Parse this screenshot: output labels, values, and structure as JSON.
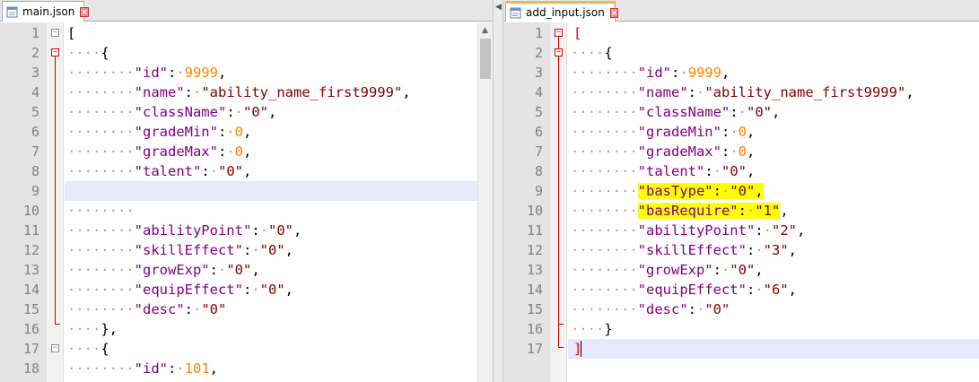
{
  "left_tab": {
    "label": "main.json",
    "icon": "json-file-icon",
    "close": "close-tab-icon"
  },
  "right_tab": {
    "label": "add_input.json",
    "icon": "json-file-icon",
    "close": "close-tab-icon"
  },
  "left_lines": [
    "1",
    "2",
    "3",
    "4",
    "5",
    "6",
    "7",
    "8",
    "9",
    "10",
    "11",
    "12",
    "13",
    "14",
    "15",
    "16",
    "17",
    "18"
  ],
  "right_lines": [
    "1",
    "2",
    "3",
    "4",
    "5",
    "6",
    "7",
    "8",
    "9",
    "10",
    "11",
    "12",
    "13",
    "14",
    "15",
    "16",
    "17"
  ],
  "left_code": {
    "l1_open": "[",
    "l2_open": "{",
    "id_key": "\"id\"",
    "id_val": "9999",
    "name_key": "\"name\"",
    "name_val": "\"ability_name_first9999\"",
    "className_key": "\"className\"",
    "className_val": "\"0\"",
    "gradeMin_key": "\"gradeMin\"",
    "gradeMin_val": "0",
    "gradeMax_key": "\"gradeMax\"",
    "gradeMax_val": "0",
    "talent_key": "\"talent\"",
    "talent_val": "\"0\"",
    "abilityPoint_key": "\"abilityPoint\"",
    "abilityPoint_val": "\"0\"",
    "skillEffect_key": "\"skillEffect\"",
    "skillEffect_val": "\"0\"",
    "growExp_key": "\"growExp\"",
    "growExp_val": "\"0\"",
    "equipEffect_key": "\"equipEffect\"",
    "equipEffect_val": "\"0\"",
    "desc_key": "\"desc\"",
    "desc_val": "\"0\"",
    "l16_close": "},",
    "l17_open": "{",
    "id2_key": "\"id\"",
    "id2_val": "101"
  },
  "right_code": {
    "l1_open": "[",
    "l2_open": "{",
    "id_key": "\"id\"",
    "id_val": "9999",
    "name_key": "\"name\"",
    "name_val": "\"ability_name_first9999\"",
    "className_key": "\"className\"",
    "className_val": "\"0\"",
    "gradeMin_key": "\"gradeMin\"",
    "gradeMin_val": "0",
    "gradeMax_key": "\"gradeMax\"",
    "gradeMax_val": "0",
    "talent_key": "\"talent\"",
    "talent_val": "\"0\"",
    "basType_key": "\"basType\"",
    "basType_val": "\"0\"",
    "basRequire_key": "\"basRequire\"",
    "basRequire_val": "\"1\"",
    "abilityPoint_key": "\"abilityPoint\"",
    "abilityPoint_val": "\"2\"",
    "skillEffect_key": "\"skillEffect\"",
    "skillEffect_val": "\"3\"",
    "growExp_key": "\"growExp\"",
    "growExp_val": "\"0\"",
    "equipEffect_key": "\"equipEffect\"",
    "equipEffect_val": "\"6\"",
    "desc_key": "\"desc\"",
    "desc_val": "\"0\"",
    "l16_close": "}",
    "l17_close": "]"
  },
  "colors": {
    "highlight_yellow": "#ffff00",
    "current_line": "#e8e8ff",
    "key_purple": "#800080",
    "string_maroon": "#800000",
    "number_orange": "#ff8000",
    "fold_red": "#cc0000"
  }
}
